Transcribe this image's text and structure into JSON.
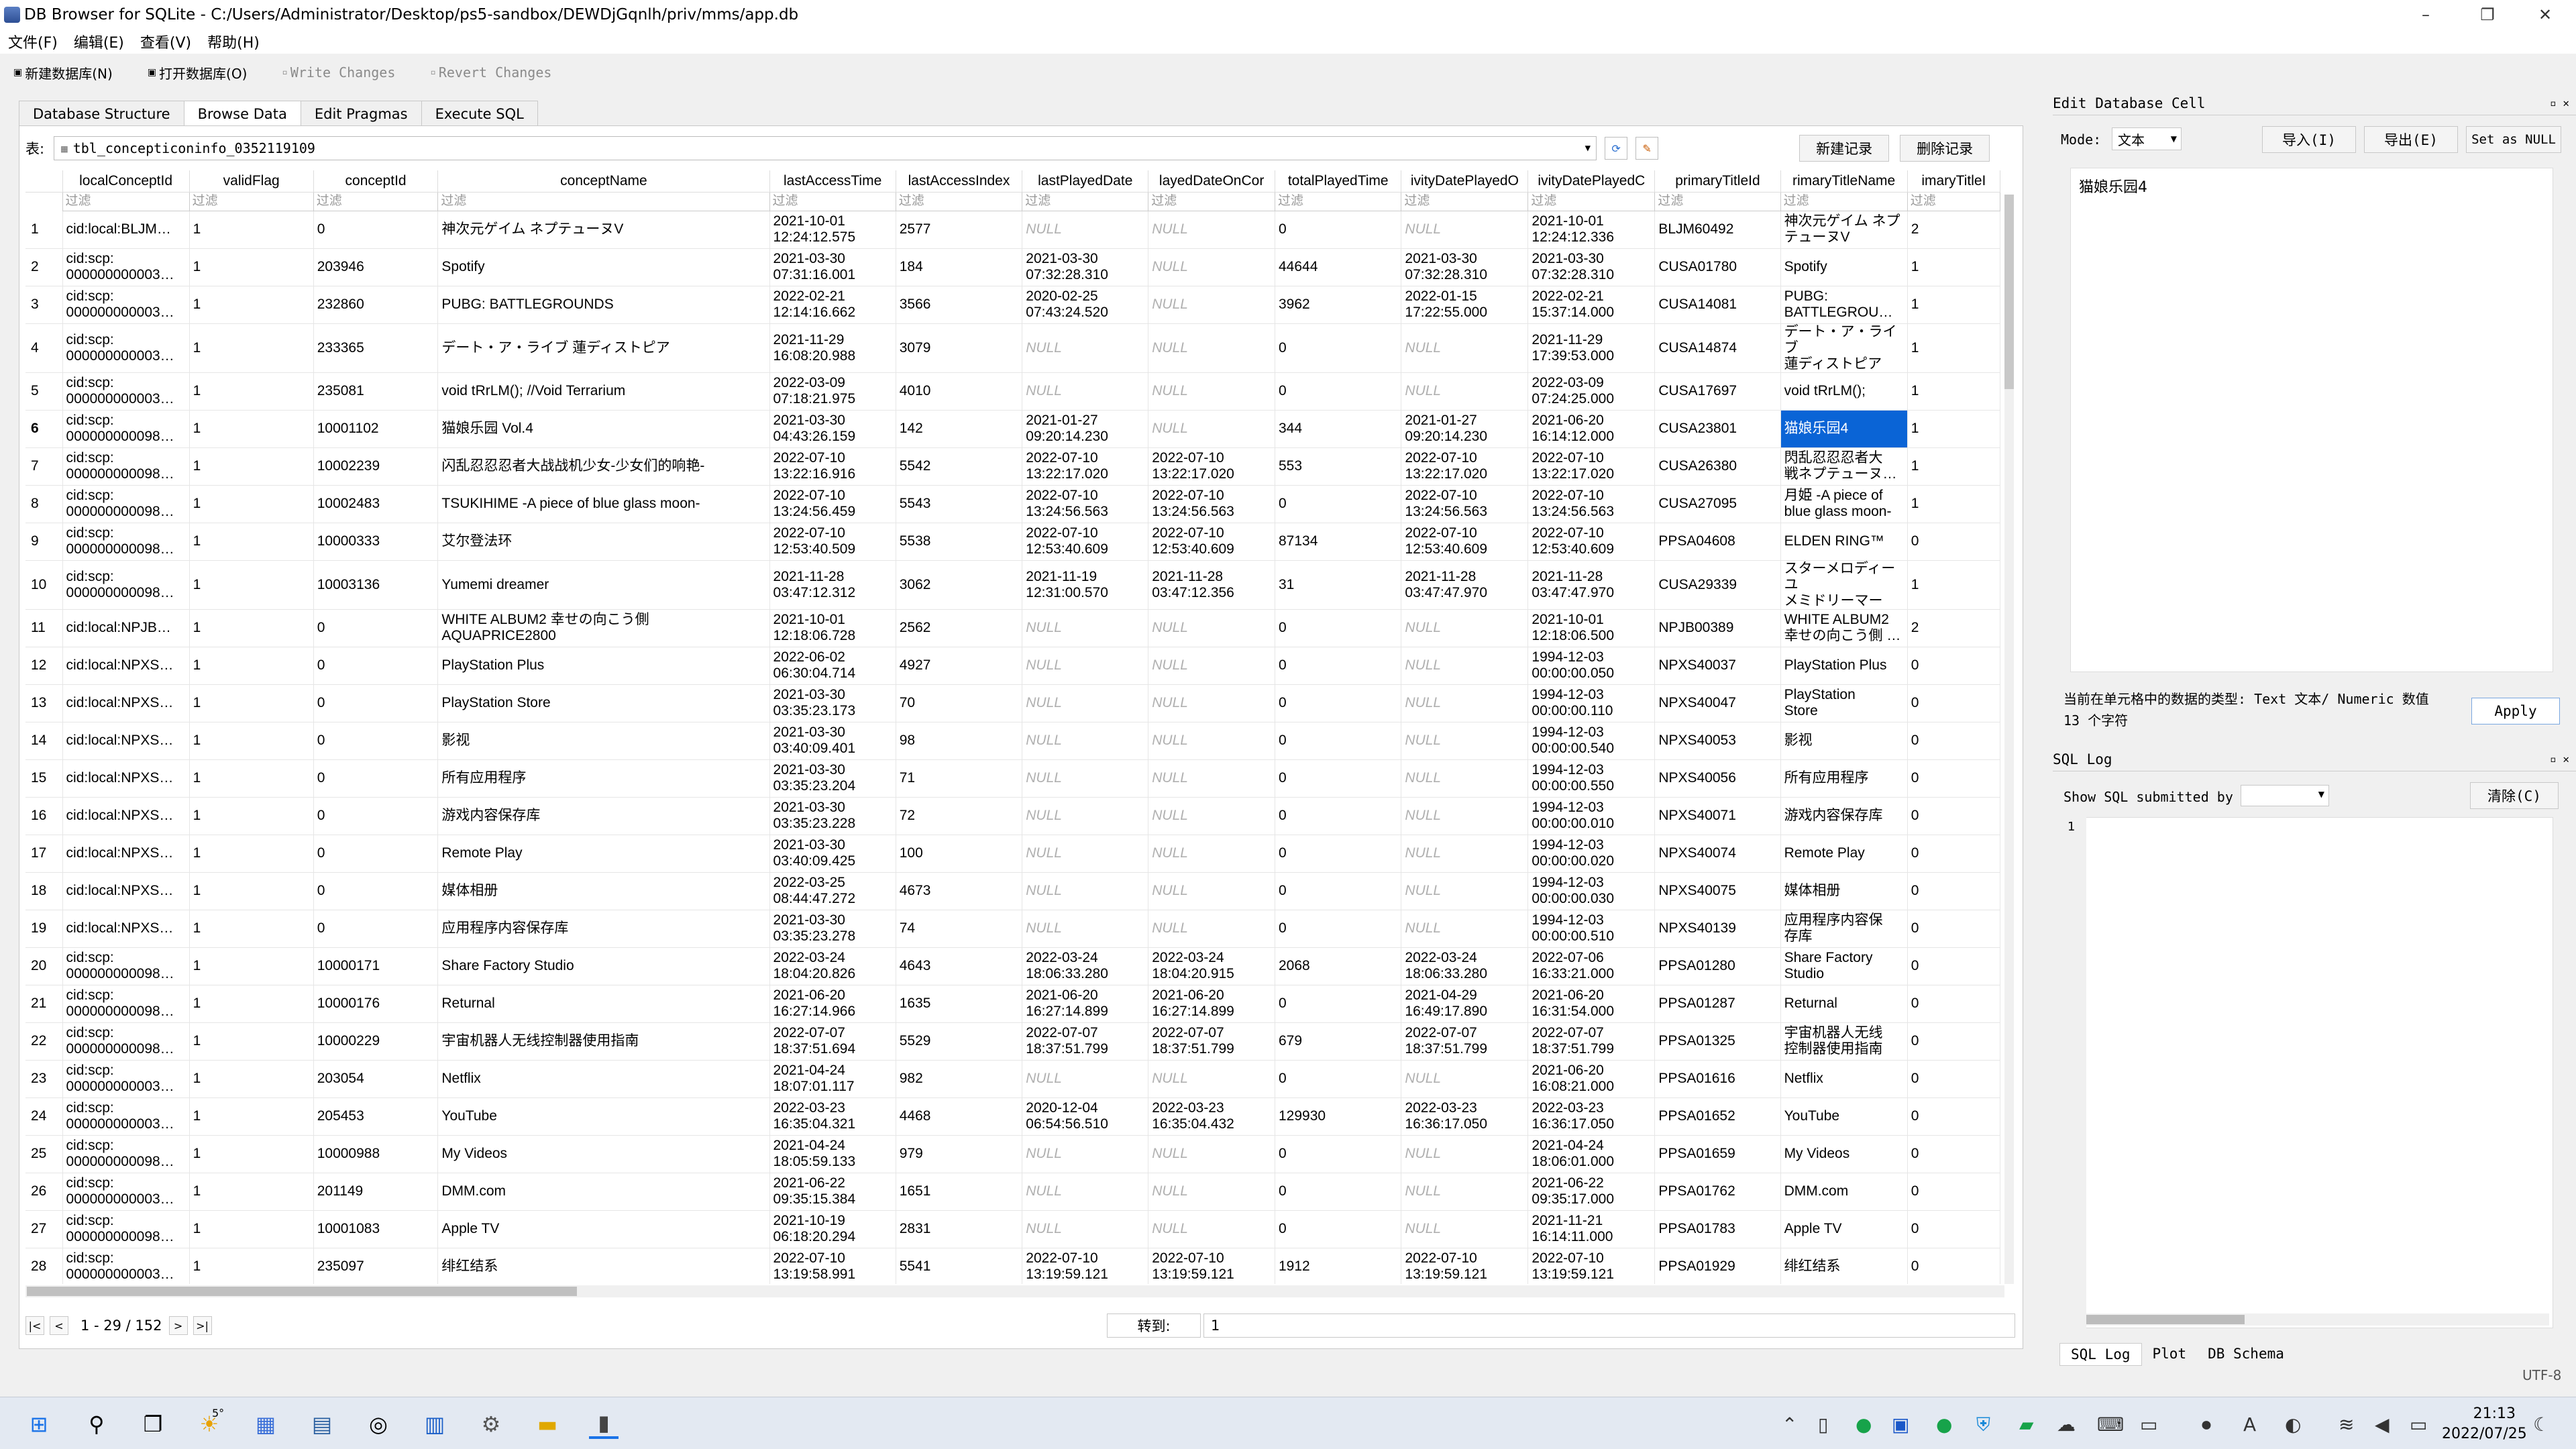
{
  "window": {
    "title": "DB Browser for SQLite - C:/Users/Administrator/Desktop/ps5-sandbox/DEWDjGqnlh/priv/mms/app.db",
    "minimize": "–",
    "maximize": "❐",
    "close": "✕"
  },
  "menu": [
    "文件(F)",
    "编辑(E)",
    "查看(V)",
    "帮助(H)"
  ],
  "toolbar": {
    "new_db": "新建数据库(N)",
    "open_db": "打开数据库(O)",
    "write": "Write Changes",
    "revert": "Revert Changes"
  },
  "tabs": [
    "Database Structure",
    "Browse Data",
    "Edit Pragmas",
    "Execute SQL"
  ],
  "browse": {
    "table_label": "表:",
    "table_name": "tbl_concepticoninfo_0352119109",
    "new_record": "新建记录",
    "delete_record": "删除记录",
    "filter_placeholder": "过滤",
    "columns": [
      "localConceptId",
      "validFlag",
      "conceptId",
      "conceptName",
      "lastAccessTime",
      "lastAccessIndex",
      "lastPlayedDate",
      "layedDateOnCor",
      "totalPlayedTime",
      "ivityDatePlayedO",
      "ivityDatePlayedC",
      "primaryTitleId",
      "rimaryTitleName",
      "imaryTitleI"
    ],
    "rows": [
      [
        "1",
        "cid:local:BLJM…",
        "1",
        "0",
        "神次元ゲイム ネプテューヌV",
        "2021-10-01\n12:24:12.575",
        "2577",
        "NULL",
        "NULL",
        "0",
        "NULL",
        "2021-10-01\n12:24:12.336",
        "BLJM60492",
        "神次元ゲイム ネプ\nテューヌV",
        "2"
      ],
      [
        "2",
        "cid:scp:\n000000000003…",
        "1",
        "203946",
        "Spotify",
        "2021-03-30\n07:31:16.001",
        "184",
        "2021-03-30\n07:32:28.310",
        "NULL",
        "44644",
        "2021-03-30\n07:32:28.310",
        "2021-03-30\n07:32:28.310",
        "CUSA01780",
        "Spotify",
        "1"
      ],
      [
        "3",
        "cid:scp:\n000000000003…",
        "1",
        "232860",
        "PUBG: BATTLEGROUNDS",
        "2022-02-21\n12:14:16.662",
        "3566",
        "2020-02-25\n07:43:24.520",
        "NULL",
        "3962",
        "2022-01-15\n17:22:55.000",
        "2022-02-21\n15:37:14.000",
        "CUSA14081",
        "PUBG:\nBATTLEGROU…",
        "1"
      ],
      [
        "4",
        "cid:scp:\n000000000003…",
        "1",
        "233365",
        "デート・ア・ライブ 蓮ディストピア",
        "2021-11-29\n16:08:20.988",
        "3079",
        "NULL",
        "NULL",
        "0",
        "NULL",
        "2021-11-29\n17:39:53.000",
        "CUSA14874",
        "デート・ア・ライブ\n蓮ディストピア",
        "1"
      ],
      [
        "5",
        "cid:scp:\n000000000003…",
        "1",
        "235081",
        "void tRrLM(); //Void Terrarium",
        "2022-03-09\n07:18:21.975",
        "4010",
        "NULL",
        "NULL",
        "0",
        "NULL",
        "2022-03-09\n07:24:25.000",
        "CUSA17697",
        "void tRrLM();",
        "1"
      ],
      [
        "6",
        "cid:scp:\n000000000098…",
        "1",
        "10001102",
        "猫娘乐园 Vol.4",
        "2021-03-30\n04:43:26.159",
        "142",
        "2021-01-27\n09:20:14.230",
        "NULL",
        "344",
        "2021-01-27\n09:20:14.230",
        "2021-06-20\n16:14:12.000",
        "CUSA23801",
        "猫娘乐园4",
        "1"
      ],
      [
        "7",
        "cid:scp:\n000000000098…",
        "1",
        "10002239",
        "闪乱忍忍忍者大战战机少女-少女们的响艳-",
        "2022-07-10\n13:22:16.916",
        "5542",
        "2022-07-10\n13:22:17.020",
        "2022-07-10\n13:22:17.020",
        "553",
        "2022-07-10\n13:22:17.020",
        "2022-07-10\n13:22:17.020",
        "CUSA26380",
        "閃乱忍忍忍者大\n戦ネプテューヌ…",
        "1"
      ],
      [
        "8",
        "cid:scp:\n000000000098…",
        "1",
        "10002483",
        "TSUKIHIME -A piece of blue glass moon-",
        "2022-07-10\n13:24:56.459",
        "5543",
        "2022-07-10\n13:24:56.563",
        "2022-07-10\n13:24:56.563",
        "0",
        "2022-07-10\n13:24:56.563",
        "2022-07-10\n13:24:56.563",
        "CUSA27095",
        "月姫 -A piece of\nblue glass moon-",
        "1"
      ],
      [
        "9",
        "cid:scp:\n000000000098…",
        "1",
        "10000333",
        "艾尔登法环",
        "2022-07-10\n12:53:40.509",
        "5538",
        "2022-07-10\n12:53:40.609",
        "2022-07-10\n12:53:40.609",
        "87134",
        "2022-07-10\n12:53:40.609",
        "2022-07-10\n12:53:40.609",
        "PPSA04608",
        "ELDEN RING™",
        "0"
      ],
      [
        "10",
        "cid:scp:\n000000000098…",
        "1",
        "10003136",
        "Yumemi dreamer",
        "2021-11-28\n03:47:12.312",
        "3062",
        "2021-11-19\n12:31:00.570",
        "2021-11-28\n03:47:12.356",
        "31",
        "2021-11-28\n03:47:47.970",
        "2021-11-28\n03:47:47.970",
        "CUSA29339",
        "スターメロディー ユ\nメミドリーマー",
        "1"
      ],
      [
        "11",
        "cid:local:NPJB…",
        "1",
        "0",
        "WHITE ALBUM2 幸せの向こう側\nAQUAPRICE2800",
        "2021-10-01\n12:18:06.728",
        "2562",
        "NULL",
        "NULL",
        "0",
        "NULL",
        "2021-10-01\n12:18:06.500",
        "NPJB00389",
        "WHITE ALBUM2\n幸せの向こう側 …",
        "2"
      ],
      [
        "12",
        "cid:local:NPXS…",
        "1",
        "0",
        "PlayStation Plus",
        "2022-06-02\n06:30:04.714",
        "4927",
        "NULL",
        "NULL",
        "0",
        "NULL",
        "1994-12-03\n00:00:00.050",
        "NPXS40037",
        "PlayStation Plus",
        "0"
      ],
      [
        "13",
        "cid:local:NPXS…",
        "1",
        "0",
        "PlayStation Store",
        "2021-03-30\n03:35:23.173",
        "70",
        "NULL",
        "NULL",
        "0",
        "NULL",
        "1994-12-03\n00:00:00.110",
        "NPXS40047",
        "PlayStation\nStore",
        "0"
      ],
      [
        "14",
        "cid:local:NPXS…",
        "1",
        "0",
        "影视",
        "2021-03-30\n03:40:09.401",
        "98",
        "NULL",
        "NULL",
        "0",
        "NULL",
        "1994-12-03\n00:00:00.540",
        "NPXS40053",
        "影视",
        "0"
      ],
      [
        "15",
        "cid:local:NPXS…",
        "1",
        "0",
        "所有应用程序",
        "2021-03-30\n03:35:23.204",
        "71",
        "NULL",
        "NULL",
        "0",
        "NULL",
        "1994-12-03\n00:00:00.550",
        "NPXS40056",
        "所有应用程序",
        "0"
      ],
      [
        "16",
        "cid:local:NPXS…",
        "1",
        "0",
        "游戏内容保存库",
        "2021-03-30\n03:35:23.228",
        "72",
        "NULL",
        "NULL",
        "0",
        "NULL",
        "1994-12-03\n00:00:00.010",
        "NPXS40071",
        "游戏内容保存库",
        "0"
      ],
      [
        "17",
        "cid:local:NPXS…",
        "1",
        "0",
        "Remote Play",
        "2021-03-30\n03:40:09.425",
        "100",
        "NULL",
        "NULL",
        "0",
        "NULL",
        "1994-12-03\n00:00:00.020",
        "NPXS40074",
        "Remote Play",
        "0"
      ],
      [
        "18",
        "cid:local:NPXS…",
        "1",
        "0",
        "媒体相册",
        "2022-03-25\n08:44:47.272",
        "4673",
        "NULL",
        "NULL",
        "0",
        "NULL",
        "1994-12-03\n00:00:00.030",
        "NPXS40075",
        "媒体相册",
        "0"
      ],
      [
        "19",
        "cid:local:NPXS…",
        "1",
        "0",
        "应用程序内容保存库",
        "2021-03-30\n03:35:23.278",
        "74",
        "NULL",
        "NULL",
        "0",
        "NULL",
        "1994-12-03\n00:00:00.510",
        "NPXS40139",
        "应用程序内容保\n存库",
        "0"
      ],
      [
        "20",
        "cid:scp:\n000000000098…",
        "1",
        "10000171",
        "Share Factory Studio",
        "2022-03-24\n18:04:20.826",
        "4643",
        "2022-03-24\n18:06:33.280",
        "2022-03-24\n18:04:20.915",
        "2068",
        "2022-03-24\n18:06:33.280",
        "2022-07-06\n16:33:21.000",
        "PPSA01280",
        "Share Factory\nStudio",
        "0"
      ],
      [
        "21",
        "cid:scp:\n000000000098…",
        "1",
        "10000176",
        "Returnal",
        "2021-06-20\n16:27:14.966",
        "1635",
        "2021-06-20\n16:27:14.899",
        "2021-06-20\n16:27:14.899",
        "0",
        "2021-04-29\n16:49:17.890",
        "2021-06-20\n16:31:54.000",
        "PPSA01287",
        "Returnal",
        "0"
      ],
      [
        "22",
        "cid:scp:\n000000000098…",
        "1",
        "10000229",
        "宇宙机器人无线控制器使用指南",
        "2022-07-07\n18:37:51.694",
        "5529",
        "2022-07-07\n18:37:51.799",
        "2022-07-07\n18:37:51.799",
        "679",
        "2022-07-07\n18:37:51.799",
        "2022-07-07\n18:37:51.799",
        "PPSA01325",
        "宇宙机器人无线\n控制器使用指南",
        "0"
      ],
      [
        "23",
        "cid:scp:\n000000000003…",
        "1",
        "203054",
        "Netflix",
        "2021-04-24\n18:07:01.117",
        "982",
        "NULL",
        "NULL",
        "0",
        "NULL",
        "2021-06-20\n16:08:21.000",
        "PPSA01616",
        "Netflix",
        "0"
      ],
      [
        "24",
        "cid:scp:\n000000000003…",
        "1",
        "205453",
        "YouTube",
        "2022-03-23\n16:35:04.321",
        "4468",
        "2020-12-04\n06:54:56.510",
        "2022-03-23\n16:35:04.432",
        "129930",
        "2022-03-23\n16:36:17.050",
        "2022-03-23\n16:36:17.050",
        "PPSA01652",
        "YouTube",
        "0"
      ],
      [
        "25",
        "cid:scp:\n000000000098…",
        "1",
        "10000988",
        "My Videos",
        "2021-04-24\n18:05:59.133",
        "979",
        "NULL",
        "NULL",
        "0",
        "NULL",
        "2021-04-24\n18:06:01.000",
        "PPSA01659",
        "My Videos",
        "0"
      ],
      [
        "26",
        "cid:scp:\n000000000003…",
        "1",
        "201149",
        "DMM.com",
        "2021-06-22\n09:35:15.384",
        "1651",
        "NULL",
        "NULL",
        "0",
        "NULL",
        "2021-06-22\n09:35:17.000",
        "PPSA01762",
        "DMM.com",
        "0"
      ],
      [
        "27",
        "cid:scp:\n000000000098…",
        "1",
        "10001083",
        "Apple TV",
        "2021-10-19\n06:18:20.294",
        "2831",
        "NULL",
        "NULL",
        "0",
        "NULL",
        "2021-11-21\n16:14:11.000",
        "PPSA01783",
        "Apple TV",
        "0"
      ],
      [
        "28",
        "cid:scp:\n000000000003…",
        "1",
        "235097",
        "绯红结系",
        "2022-07-10\n13:19:58.991",
        "5541",
        "2022-07-10\n13:19:59.121",
        "2022-07-10\n13:19:59.121",
        "1912",
        "2022-07-10\n13:19:59.121",
        "2022-07-10\n13:19:59.121",
        "PPSA01929",
        "绯红结系",
        "0"
      ]
    ],
    "selected_row": 6,
    "selected_col": 13,
    "pager": "1 - 29 / 152",
    "goto_label": "转到:",
    "goto_value": "1"
  },
  "edit_cell": {
    "title": "Edit Database Cell",
    "mode_label": "Mode:",
    "mode_value": "文本",
    "import": "导入(I)",
    "export": "导出(E)",
    "set_null": "Set as NULL",
    "content": "猫娘乐园4",
    "type_info_1": "当前在单元格中的数据的类型: Text 文本/ Numeric 数值",
    "type_info_2": "13 个字符",
    "apply": "Apply"
  },
  "sql_log": {
    "title": "SQL Log",
    "show_label": "Show SQL submitted by",
    "clear": "清除(C)",
    "line1": "1"
  },
  "bottom_tabs": [
    "SQL Log",
    "Plot",
    "DB Schema"
  ],
  "status": "UTF-8",
  "clock": {
    "time": "21:13",
    "date": "2022/07/25"
  },
  "taskbar": {
    "badge": "5°"
  }
}
